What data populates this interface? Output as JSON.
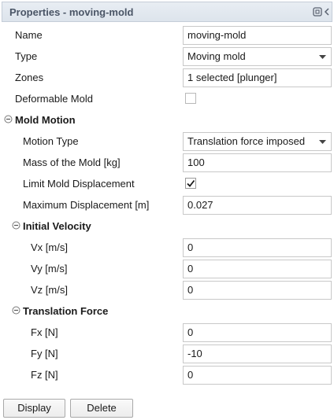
{
  "panel": {
    "title": "Properties - moving-mold",
    "icons": {
      "detach": "detach-icon",
      "collapse": "chevron-left-icon"
    }
  },
  "properties": {
    "name": {
      "label": "Name",
      "value": "moving-mold"
    },
    "type": {
      "label": "Type",
      "value": "Moving mold"
    },
    "zones": {
      "label": "Zones",
      "value": "1 selected [plunger]"
    },
    "deformable_mold": {
      "label": "Deformable Mold",
      "checked": false
    }
  },
  "mold_motion": {
    "label": "Mold Motion",
    "motion_type": {
      "label": "Motion Type",
      "value": "Translation force imposed"
    },
    "mass": {
      "label": "Mass of the Mold [kg]",
      "value": "100"
    },
    "limit_displacement": {
      "label": "Limit Mold Displacement",
      "checked": true
    },
    "max_displacement": {
      "label": "Maximum Displacement [m]",
      "value": "0.027"
    }
  },
  "initial_velocity": {
    "label": "Initial Velocity",
    "vx": {
      "label": "Vx [m/s]",
      "value": "0"
    },
    "vy": {
      "label": "Vy [m/s]",
      "value": "0"
    },
    "vz": {
      "label": "Vz [m/s]",
      "value": "0"
    }
  },
  "translation_force": {
    "label": "Translation Force",
    "fx": {
      "label": "Fx [N]",
      "value": "0"
    },
    "fy": {
      "label": "Fy [N]",
      "value": "-10"
    },
    "fz": {
      "label": "Fz [N]",
      "value": "0"
    }
  },
  "buttons": {
    "display": "Display",
    "delete": "Delete"
  },
  "colors": {
    "title_text": "#4a5566",
    "title_bg": "#e2e8ef",
    "border": "#c8c8c8"
  }
}
